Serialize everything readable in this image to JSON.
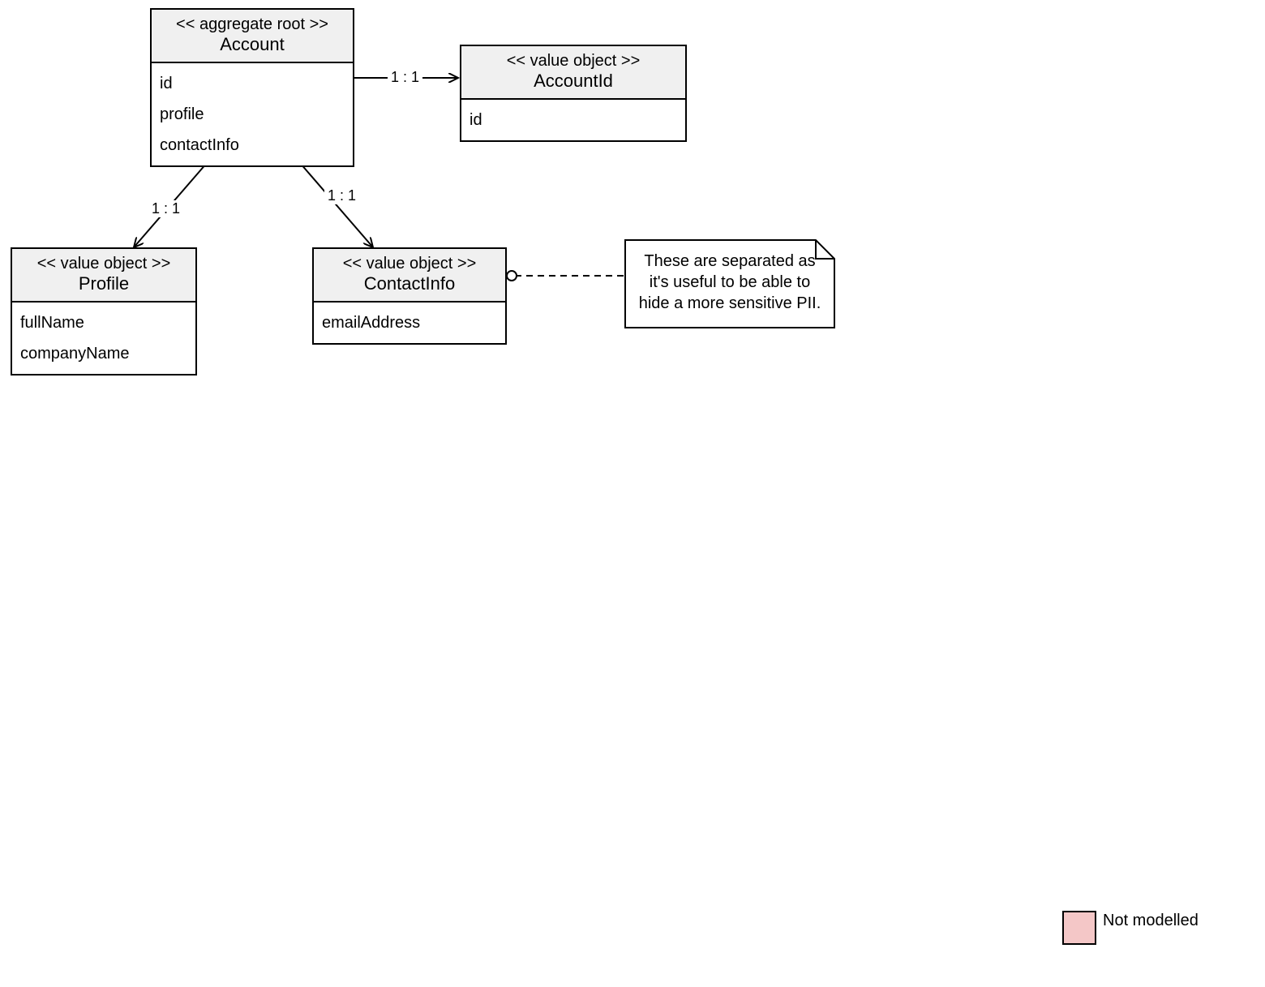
{
  "classes": {
    "account": {
      "stereotype": "<< aggregate root >>",
      "name": "Account",
      "attrs": [
        "id",
        "profile",
        "contactInfo"
      ]
    },
    "accountId": {
      "stereotype": "<< value object >>",
      "name": "AccountId",
      "attrs": [
        "id"
      ]
    },
    "profile": {
      "stereotype": "<< value object >>",
      "name": "Profile",
      "attrs": [
        "fullName",
        "companyName"
      ]
    },
    "contactInfo": {
      "stereotype": "<< value object >>",
      "name": "ContactInfo",
      "attrs": [
        "emailAddress"
      ]
    }
  },
  "edges": {
    "account_to_accountId": "1 : 1",
    "account_to_profile": "1 : 1",
    "account_to_contactInfo": "1 : 1"
  },
  "note": {
    "text": "These are separated as it's useful to be able to hide a more sensitive PII."
  },
  "legend": {
    "label": "Not modelled"
  }
}
